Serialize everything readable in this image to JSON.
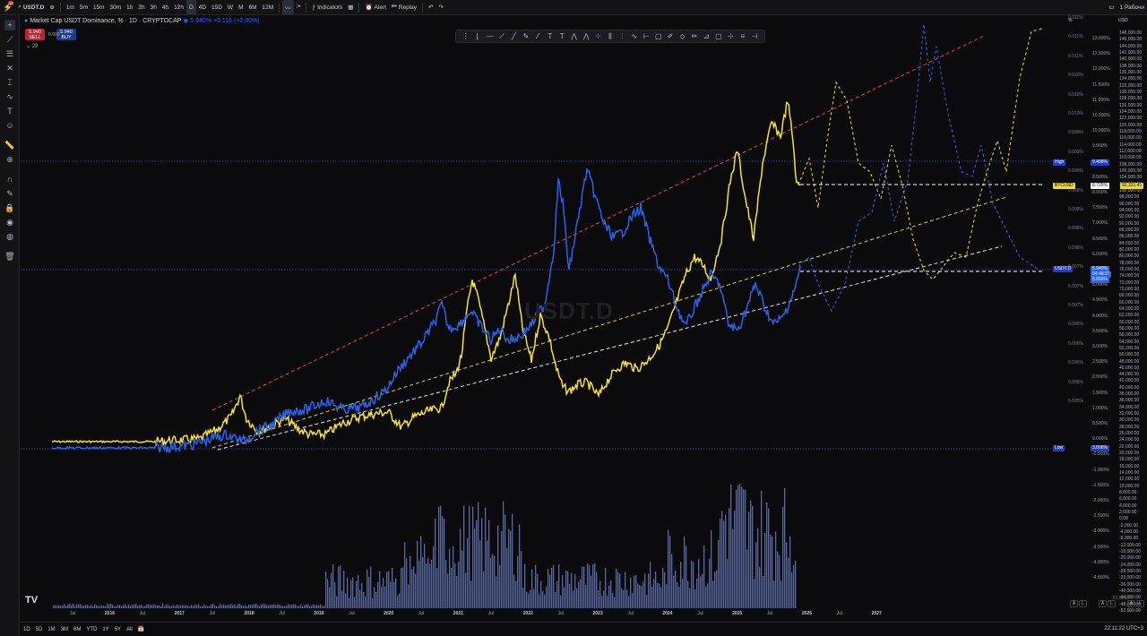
{
  "toolbar": {
    "symbol": "USDT.D",
    "timeframes": [
      "1m",
      "5m",
      "15m",
      "30m",
      "1h",
      "2h",
      "3h",
      "4h",
      "12h",
      "D",
      "4D",
      "15D",
      "W",
      "M",
      "6M",
      "12M"
    ],
    "active_timeframe": "D",
    "indicators_label": "Indicators",
    "alert_label": "Alert",
    "replay_label": "Replay",
    "workspace_label": "1 Рабочи",
    "notification_count": "19"
  },
  "legend": {
    "title": "Market Cap USDT Dominance, % · 1D · CRYPTOCAP",
    "values": "5.940% +0.116 (+2.00%)",
    "sell_price": "5.940",
    "sell_label": "SELL",
    "spread": "0.000",
    "buy_price": "5.940",
    "buy_label": "BUY",
    "indicator_count": "29"
  },
  "watermark": "USDT.D",
  "right_scale": {
    "currency": "USD",
    "percent_symbol": "%",
    "usd_ticks": [
      "148,000.00",
      "146,000.00",
      "144,000.00",
      "142,000.00",
      "140,000.00",
      "138,000.00",
      "136,000.00",
      "134,000.00",
      "132,000.00",
      "130,000.00",
      "128,000.00",
      "126,000.00",
      "124,000.00",
      "122,000.00",
      "120,000.00",
      "118,000.00",
      "116,000.00",
      "114,000.00",
      "112,000.00",
      "110,000.00",
      "108,000.00",
      "106,000.00",
      "104,000.00",
      "102,000.00",
      "100,000.00",
      "98,000.00",
      "96,000.00",
      "94,000.00",
      "92,000.00",
      "90,000.00",
      "88,000.00",
      "86,000.00",
      "84,000.00",
      "82,000.00",
      "80,000.00",
      "78,000.00",
      "76,000.00",
      "74,000.00",
      "72,000.00",
      "70,000.00",
      "68,000.00",
      "66,000.00",
      "64,000.00",
      "62,000.00",
      "60,000.00",
      "58,000.00",
      "56,000.00",
      "54,000.00",
      "52,000.00",
      "50,000.00",
      "48,000.00",
      "46,000.00",
      "44,000.00",
      "42,000.00",
      "40,000.00",
      "38,000.00",
      "36,000.00",
      "34,000.00",
      "32,000.00",
      "30,000.00",
      "28,000.00",
      "26,000.00",
      "24,000.00",
      "22,000.00",
      "20,000.00",
      "18,000.00",
      "16,000.00",
      "14,000.00",
      "12,000.00",
      "10,000.00",
      "8,000.00",
      "6,000.00",
      "4,000.00",
      "2,000.00",
      "0.00",
      "-2,000.00",
      "-4,000.00",
      "-8,000.00",
      "-12,000.00",
      "-16,000.00",
      "-20,000.00",
      "-24,000.00",
      "-28,000.00",
      "-32,000.00",
      "-36,000.00",
      "-40,000.00",
      "-44,000.00",
      "-48,000.00",
      "-52,000.00"
    ],
    "pct_ticks": [
      "13.000%",
      "12.500%",
      "12.000%",
      "11.500%",
      "11.000%",
      "10.500%",
      "10.000%",
      "9.500%",
      "9.000%",
      "8.500%",
      "8.000%",
      "7.500%",
      "7.000%",
      "6.500%",
      "6.000%",
      "5.500%",
      "5.000%",
      "4.500%",
      "4.000%",
      "3.500%",
      "3.000%",
      "2.500%",
      "2.000%",
      "1.500%",
      "1.000%",
      "0.500%",
      "0.000%",
      "-0.500%",
      "-1.000%",
      "-1.500%",
      "-2.000%",
      "-2.500%",
      "-3.000%",
      "-3.500%",
      "-4.000%",
      "-4.500%"
    ],
    "tiny_pct_ticks": [
      "0.011%",
      "0.011%",
      "0.011%",
      "0.010%",
      "0.010%",
      "0.010%",
      "0.009%",
      "0.009%",
      "0.009%",
      "0.008%",
      "0.008%",
      "0.008%",
      "0.008%",
      "0.007%",
      "0.007%",
      "0.007%",
      "0.006%",
      "0.006%",
      "0.006%",
      "0.005%",
      "0.005%"
    ],
    "high_label": "High",
    "high_value": "9.488%",
    "btc_pct": "8.725%",
    "btc_price": "92,321.41",
    "btc_label": "BTCUSD",
    "usdt_value": "5.940%",
    "usdt_countdown": "04:48:37",
    "usdt_value2": "5.656%",
    "usdt_label": "USDT.D",
    "low_label": "Low",
    "low_value": "3.006%",
    "bottom_value": "-52,000.00"
  },
  "x_axis": {
    "labels": [
      "Jul",
      "2016",
      "Jul",
      "2017",
      "Jul",
      "2018",
      "Jul",
      "2019",
      "Jul",
      "2020",
      "Jul",
      "2021",
      "Jul",
      "2022",
      "Jul",
      "2023",
      "Jul",
      "2024",
      "Jul",
      "2025",
      "Jul",
      "2026",
      "Jul",
      "2027"
    ]
  },
  "bottom_bar": {
    "ranges": [
      "1D",
      "5D",
      "1M",
      "3M",
      "6M",
      "YTD",
      "1Y",
      "5Y",
      "All"
    ],
    "clock": "22:11:22 UTC+3"
  },
  "colors": {
    "usdt_line": "#2a63e8",
    "btc_line": "#f5e03a",
    "red_channel": "#e0424a",
    "yellow_channel": "#d9cd3a",
    "white_channel": "#e8e8e8",
    "hline_blue": "#2c4dbf",
    "volume": "#4c79ff"
  }
}
